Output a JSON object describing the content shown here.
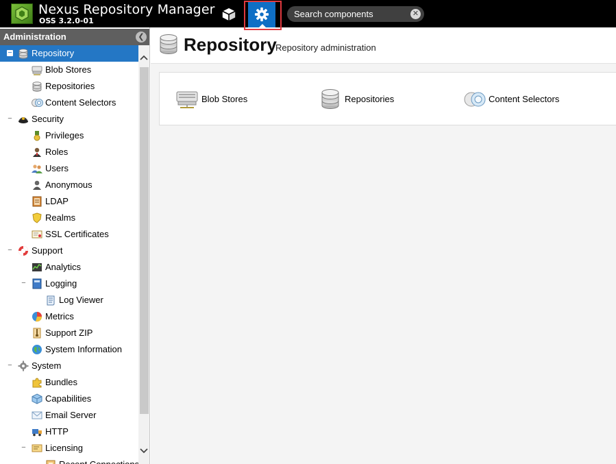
{
  "header": {
    "app_title": "Nexus Repository Manager",
    "app_version": "OSS 3.2.0-01",
    "search_placeholder": "Search components",
    "browse_icon": "cube-icon",
    "admin_icon": "gear-icon",
    "admin_highlight_color": "#e0393e",
    "admin_active_color": "#0f6fc5"
  },
  "sidebar": {
    "title": "Administration",
    "selected_color": "#2477c5",
    "items": [
      {
        "label": "Repository",
        "icon": "database-icon",
        "level": 0,
        "toggle": "−",
        "selected": true
      },
      {
        "label": "Blob Stores",
        "icon": "blob-store-icon",
        "level": 1
      },
      {
        "label": "Repositories",
        "icon": "database-icon",
        "level": 1
      },
      {
        "label": "Content Selectors",
        "icon": "content-selector-icon",
        "level": 1
      },
      {
        "label": "Security",
        "icon": "police-hat-icon",
        "level": 0,
        "toggle": "−"
      },
      {
        "label": "Privileges",
        "icon": "medal-icon",
        "level": 1
      },
      {
        "label": "Roles",
        "icon": "user-role-icon",
        "level": 1
      },
      {
        "label": "Users",
        "icon": "users-icon",
        "level": 1
      },
      {
        "label": "Anonymous",
        "icon": "anonymous-user-icon",
        "level": 1
      },
      {
        "label": "LDAP",
        "icon": "address-book-icon",
        "level": 1
      },
      {
        "label": "Realms",
        "icon": "shield-icon",
        "level": 1
      },
      {
        "label": "SSL Certificates",
        "icon": "certificate-icon",
        "level": 1
      },
      {
        "label": "Support",
        "icon": "lifebuoy-icon",
        "level": 0,
        "toggle": "−"
      },
      {
        "label": "Analytics",
        "icon": "analytics-icon",
        "level": 1
      },
      {
        "label": "Logging",
        "icon": "book-icon",
        "level": 1,
        "toggle": "−"
      },
      {
        "label": "Log Viewer",
        "icon": "scroll-icon",
        "level": 2
      },
      {
        "label": "Metrics",
        "icon": "pie-chart-icon",
        "level": 1
      },
      {
        "label": "Support ZIP",
        "icon": "zip-icon",
        "level": 1
      },
      {
        "label": "System Information",
        "icon": "globe-icon",
        "level": 1
      },
      {
        "label": "System",
        "icon": "gear-icon",
        "level": 0,
        "toggle": "−"
      },
      {
        "label": "Bundles",
        "icon": "puzzle-icon",
        "level": 1
      },
      {
        "label": "Capabilities",
        "icon": "box-icon",
        "level": 1
      },
      {
        "label": "Email Server",
        "icon": "envelope-icon",
        "level": 1
      },
      {
        "label": "HTTP",
        "icon": "truck-icon",
        "level": 1
      },
      {
        "label": "Licensing",
        "icon": "license-icon",
        "level": 1,
        "toggle": "−"
      },
      {
        "label": "Recent Connections",
        "icon": "connection-icon",
        "level": 2
      }
    ]
  },
  "main": {
    "title": "Repository",
    "subtitle": "Repository administration",
    "title_icon": "database-icon",
    "features": [
      {
        "label": "Blob Stores",
        "icon": "blob-store-icon"
      },
      {
        "label": "Repositories",
        "icon": "database-icon"
      },
      {
        "label": "Content Selectors",
        "icon": "content-selector-icon"
      }
    ]
  }
}
